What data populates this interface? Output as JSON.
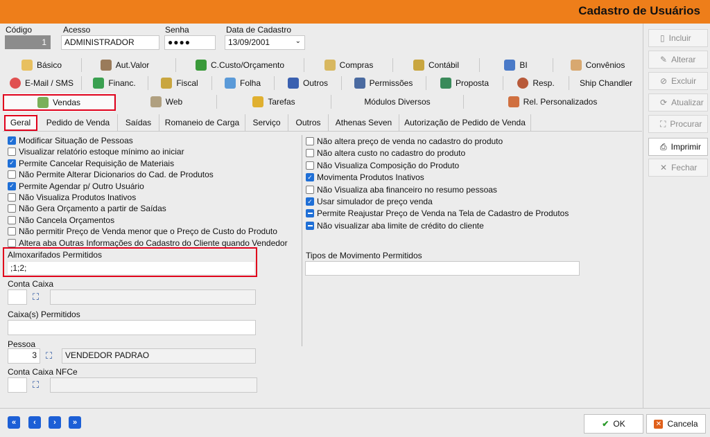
{
  "window": {
    "title": "Cadastro de Usuários"
  },
  "header": {
    "codigo_label": "Código",
    "codigo_value": "1",
    "acesso_label": "Acesso",
    "acesso_value": "ADMINISTRADOR",
    "senha_label": "Senha",
    "senha_value": "●●●●",
    "data_label": "Data de Cadastro",
    "data_value": "13/09/2001"
  },
  "main_tabs": {
    "row1": [
      "Básico",
      "Aut.Valor",
      "C.Custo/Orçamento",
      "Compras",
      "Contábil",
      "BI",
      "Convênios"
    ],
    "row2": [
      "E-Mail / SMS",
      "Financ.",
      "Fiscal",
      "Folha",
      "Outros",
      "Permissões",
      "Proposta",
      "Resp.",
      "Ship Chandler"
    ],
    "row3": [
      "Vendas",
      "Web",
      "Tarefas",
      "Módulos Diversos",
      "Rel. Personalizados"
    ]
  },
  "sub_tabs": [
    "Geral",
    "Pedido de Venda",
    "Saídas",
    "Romaneio de Carga",
    "Serviço",
    "Outros",
    "Athenas Seven",
    "Autorização de Pedido de Venda"
  ],
  "left_checks": [
    {
      "label": "Modificar Situação de Pessoas",
      "state": "on"
    },
    {
      "label": "Visualizar relatório estoque mínimo ao iniciar",
      "state": "off"
    },
    {
      "label": "Permite Cancelar Requisição de Materiais",
      "state": "on"
    },
    {
      "label": "Não Permite Alterar Dicionarios do Cad. de Produtos",
      "state": "off"
    },
    {
      "label": "Permite Agendar p/ Outro Usuário",
      "state": "on"
    },
    {
      "label": "Não Visualiza Produtos Inativos",
      "state": "off"
    },
    {
      "label": "Não Gera Orçamento a partir de Saídas",
      "state": "off"
    },
    {
      "label": "Não Cancela Orçamentos",
      "state": "off"
    },
    {
      "label": "Não permitir Preço de Venda menor que o Preço de Custo do Produto",
      "state": "off"
    },
    {
      "label": "Altera aba Outras Informações do Cadastro do Cliente quando Vendedor",
      "state": "off"
    }
  ],
  "right_checks": [
    {
      "label": "Não altera preço de venda no cadastro do produto",
      "state": "off"
    },
    {
      "label": "Não altera custo no cadastro do produto",
      "state": "off"
    },
    {
      "label": "Não Visualiza Composição do Produto",
      "state": "off"
    },
    {
      "label": "Movimenta Produtos Inativos",
      "state": "on"
    },
    {
      "label": "Não Visualiza aba financeiro no resumo pessoas",
      "state": "off"
    },
    {
      "label": "Usar simulador de preço venda",
      "state": "on"
    },
    {
      "label": "Permite Reajustar Preço de Venda na Tela de Cadastro de Produtos",
      "state": "ind"
    },
    {
      "label": "Não visualizar aba limite de crédito do cliente",
      "state": "ind"
    }
  ],
  "fields": {
    "almox_label": "Almoxarifados Permitidos",
    "almox_value": ";1;2;",
    "conta_caixa_label": "Conta Caixa",
    "caixas_label": "Caixa(s) Permitidos",
    "pessoa_label": "Pessoa",
    "pessoa_code": "3",
    "pessoa_name": "VENDEDOR PADRAO",
    "nfce_label": "Conta Caixa NFCe",
    "tipos_label": "Tipos de Movimento Permitidos"
  },
  "side_buttons": [
    "Incluir",
    "Alterar",
    "Excluir",
    "Atualizar",
    "Procurar",
    "Imprimir",
    "Fechar"
  ],
  "footer": {
    "ok": "OK",
    "cancel": "Cancela",
    "nav": [
      "«",
      "‹",
      "›",
      "»"
    ]
  }
}
